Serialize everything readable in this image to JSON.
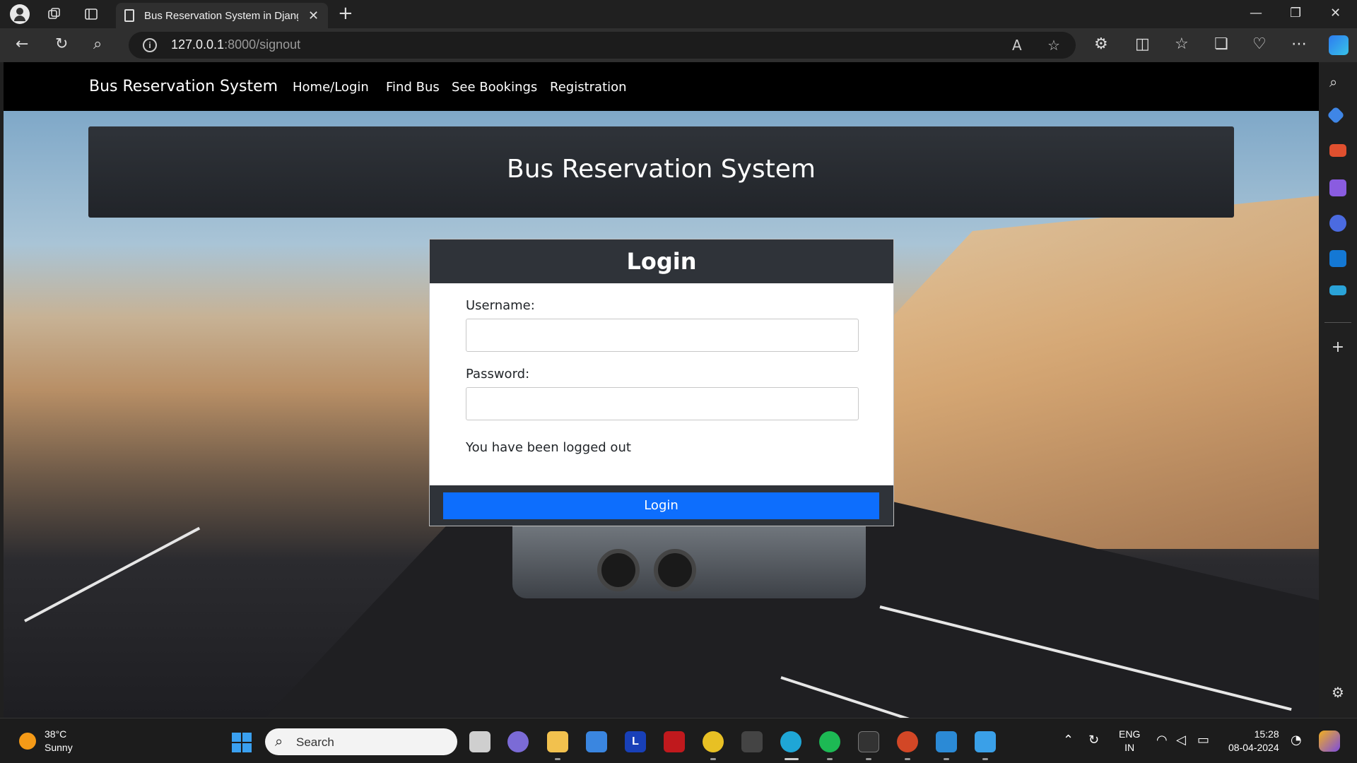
{
  "browser": {
    "tab_title": "Bus Reservation System in Djang",
    "tab_close": "✕",
    "new_tab": "+",
    "url_host": "127.0.0.1",
    "url_path": ":8000/signout",
    "window_controls": [
      "—",
      "❐",
      "✕"
    ]
  },
  "site": {
    "brand": "Bus Reservation System",
    "nav": [
      "Home/Login",
      "Find Bus",
      "See Bookings",
      "Registration"
    ],
    "hero_title": "Bus Reservation System"
  },
  "login": {
    "title": "Login",
    "username_label": "Username:",
    "username_value": "",
    "password_label": "Password:",
    "password_value": "",
    "message": "You have been logged out",
    "submit_label": "Login"
  },
  "taskbar": {
    "temperature": "38°C",
    "weather": "Sunny",
    "search_placeholder": "Search",
    "lang_1": "ENG",
    "lang_2": "IN",
    "time": "15:28",
    "date": "08-04-2024"
  },
  "colors": {
    "navbar": "#000000",
    "card_header": "#2f3339",
    "primary_button": "#0d6efd"
  }
}
